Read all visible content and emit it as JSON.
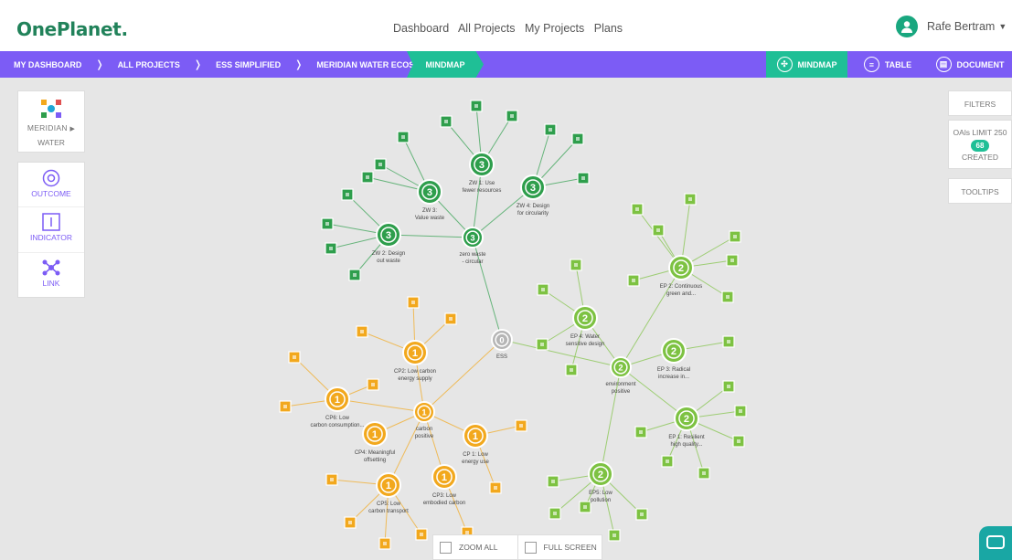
{
  "header": {
    "logo": "OnePlanet",
    "nav": [
      "Dashboard",
      "All Projects",
      "My Projects",
      "Plans"
    ],
    "user_name": "Rafe Bertram"
  },
  "breadcrumb": [
    "MY DASHBOARD",
    "ALL PROJECTS",
    "ESS SIMPLIFIED",
    "MERIDIAN WATER ECOSYSTEM"
  ],
  "current": "MINDMAP",
  "views": {
    "mindmap": "MINDMAP",
    "table": "TABLE",
    "document": "DOCUMENT"
  },
  "left_panel": {
    "project": [
      "MERIDIAN",
      "WATER"
    ],
    "tools": [
      "OUTCOME",
      "INDICATOR",
      "LINK"
    ]
  },
  "right_panel": {
    "filters": "FILTERS",
    "oals_limit": "OAls LIMIT 250",
    "count": "68",
    "created": "CREATED",
    "tooltips": "TOOLTIPS"
  },
  "bottom": {
    "zoom_all": "ZOOM ALL",
    "full_screen": "FULL SCREEN"
  },
  "colors": {
    "green": "#2e9e4c",
    "light_green": "#7dc242",
    "orange": "#f2a81d",
    "grey": "#b5b5b5",
    "purple": "#7c5cf5",
    "teal": "#1fbf96"
  },
  "mindmap": {
    "root": {
      "label": "ESS",
      "badge": "0"
    },
    "hubs": [
      {
        "label": "zero waste - circular",
        "badge": "3",
        "color": "green"
      },
      {
        "label": "environment positive",
        "badge": "2",
        "color": "light_green"
      },
      {
        "label": "carbon positive",
        "badge": "1",
        "color": "orange"
      }
    ],
    "goals": [
      {
        "label": "ZW 1: Use fewer resources",
        "badge": "3"
      },
      {
        "label": "ZW 3: Value waste",
        "badge": "3"
      },
      {
        "label": "ZW 4: Design for circularity",
        "badge": "3"
      },
      {
        "label": "ZW 2: Design out waste",
        "badge": "3"
      },
      {
        "label": "EP 2: Continuous green and...",
        "badge": "2"
      },
      {
        "label": "EP 4: Water sensitive design",
        "badge": "2"
      },
      {
        "label": "EP 3: Radical increase in...",
        "badge": "2"
      },
      {
        "label": "EP 1: Resilient high quality...",
        "badge": "2"
      },
      {
        "label": "EP5: Low pollution",
        "badge": "2"
      },
      {
        "label": "CP2: Low carbon energy supply",
        "badge": "1"
      },
      {
        "label": "CP6: Low carbon consumption...",
        "badge": "1"
      },
      {
        "label": "CP4: Meaningful offsetting",
        "badge": "1"
      },
      {
        "label": "CP 1: Low energy use",
        "badge": "1"
      },
      {
        "label": "CP5: Low carbon transport",
        "badge": "1"
      },
      {
        "label": "CP3: Low embodied carbon",
        "badge": "1"
      }
    ]
  }
}
